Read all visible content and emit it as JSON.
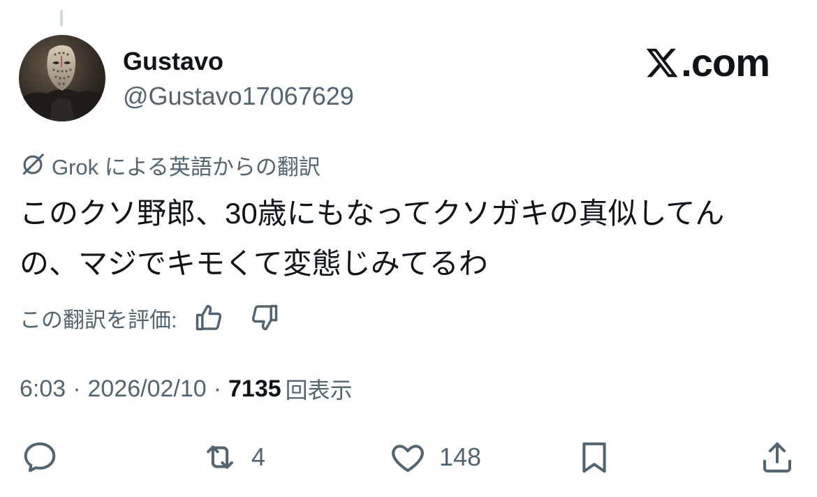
{
  "post": {
    "author": {
      "display_name": "Gustavo",
      "handle": "@Gustavo17067629",
      "avatar_icon": "avatar-masked-figure"
    },
    "brand": {
      "text": ".com",
      "logo_icon": "x-logo-icon"
    },
    "translation": {
      "label": "Grok による英語からの翻訳",
      "icon": "grok-icon"
    },
    "text_lines": [
      "このクソ野郎、30歳にもなってクソガキの真似してん",
      "の、マジでキモくて変態じみてるわ"
    ],
    "rate_translation": {
      "label": "この翻訳を評価:",
      "up_icon": "thumbs-up-icon",
      "down_icon": "thumbs-down-icon"
    },
    "meta": {
      "time": "6:03",
      "separator": "·",
      "date": "2026/02/10",
      "views": "7135",
      "views_label": "回表示"
    },
    "actions": {
      "reply": {
        "icon": "reply-icon",
        "count": ""
      },
      "repost": {
        "icon": "repost-icon",
        "count": "4"
      },
      "like": {
        "icon": "heart-icon",
        "count": "148"
      },
      "bookmark": {
        "icon": "bookmark-icon",
        "count": ""
      },
      "share": {
        "icon": "share-icon",
        "count": ""
      }
    }
  },
  "colors": {
    "text_primary": "#0f1419",
    "text_secondary": "#536471",
    "thread_line": "#cfd9de",
    "background": "#ffffff"
  }
}
